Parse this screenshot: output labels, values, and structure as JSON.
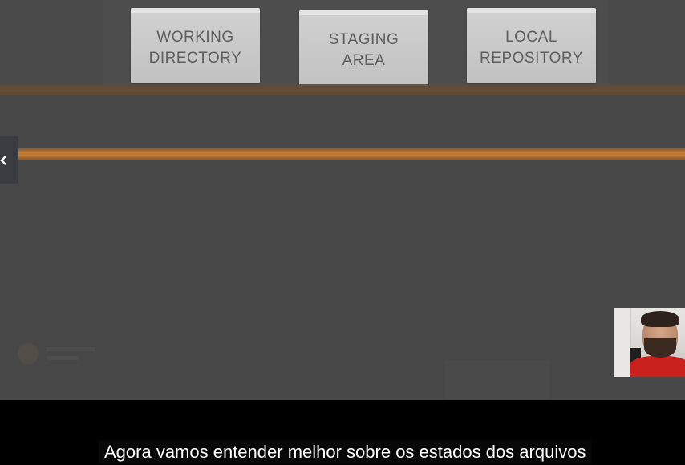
{
  "diagram": {
    "boxes": [
      {
        "label": "WORKING\nDIRECTORY"
      },
      {
        "label": "STAGING\nAREA"
      },
      {
        "label": "LOCAL\nREPOSITORY"
      }
    ],
    "accent_color": "#c07a34"
  },
  "player": {
    "prev_icon": "chevron-left-icon"
  },
  "captions": {
    "text": "Agora vamos entender melhor sobre os estados dos arquivos"
  }
}
